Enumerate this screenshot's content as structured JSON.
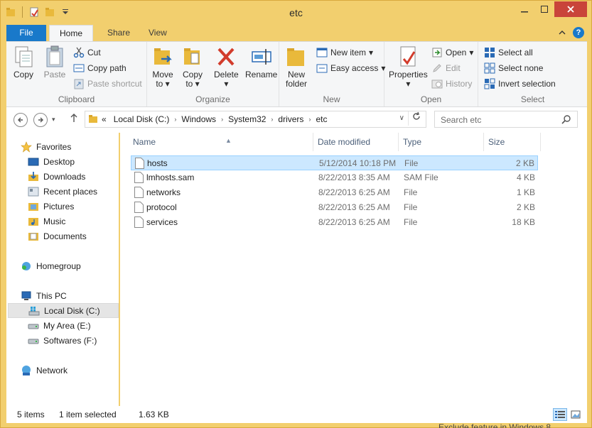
{
  "window": {
    "title": "etc"
  },
  "ribbon_tabs": [
    "File",
    "Home",
    "Share",
    "View"
  ],
  "ribbon": {
    "clipboard": {
      "name": "Clipboard",
      "copy": "Copy",
      "paste": "Paste",
      "cut": "Cut",
      "copy_path": "Copy path",
      "paste_shortcut": "Paste shortcut"
    },
    "organize": {
      "name": "Organize",
      "move_to": "Move",
      "move_to2": "to",
      "copy_to": "Copy",
      "copy_to2": "to",
      "delete": "Delete",
      "rename": "Rename"
    },
    "new": {
      "name": "New",
      "new_folder": "New",
      "new_folder2": "folder",
      "new_item": "New item",
      "easy_access": "Easy access"
    },
    "open": {
      "name": "Open",
      "properties": "Properties",
      "open": "Open",
      "edit": "Edit",
      "history": "History"
    },
    "select": {
      "name": "Select",
      "select_all": "Select all",
      "select_none": "Select none",
      "invert": "Invert selection"
    }
  },
  "address": {
    "prefix": "«",
    "crumbs": [
      "Local Disk (C:)",
      "Windows",
      "System32",
      "drivers",
      "etc"
    ],
    "search_placeholder": "Search etc"
  },
  "nav": {
    "favorites": "Favorites",
    "desktop": "Desktop",
    "downloads": "Downloads",
    "recent": "Recent places",
    "pictures": "Pictures",
    "music": "Music",
    "documents": "Documents",
    "homegroup": "Homegroup",
    "thispc": "This PC",
    "local_disk": "Local Disk (C:)",
    "my_area": "My Area (E:)",
    "softwares": "Softwares (F:)",
    "network": "Network"
  },
  "columns": {
    "name": "Name",
    "date": "Date modified",
    "type": "Type",
    "size": "Size"
  },
  "files": [
    {
      "name": "hosts",
      "date": "5/12/2014 10:18 PM",
      "type": "File",
      "size": "2 KB"
    },
    {
      "name": "lmhosts.sam",
      "date": "8/22/2013 8:35 AM",
      "type": "SAM File",
      "size": "4 KB"
    },
    {
      "name": "networks",
      "date": "8/22/2013 6:25 AM",
      "type": "File",
      "size": "1 KB"
    },
    {
      "name": "protocol",
      "date": "8/22/2013 6:25 AM",
      "type": "File",
      "size": "2 KB"
    },
    {
      "name": "services",
      "date": "8/22/2013 6:25 AM",
      "type": "File",
      "size": "18 KB"
    }
  ],
  "status": {
    "items": "5 items",
    "selected": "1 item selected",
    "size": "1.63 KB"
  },
  "background_text": "Exclude feature in Windows 8",
  "colors": {
    "title_bar": "#f2cf6e",
    "file_tab": "#1979ca",
    "selection": "#cce8ff",
    "close_button": "#c9443a"
  }
}
